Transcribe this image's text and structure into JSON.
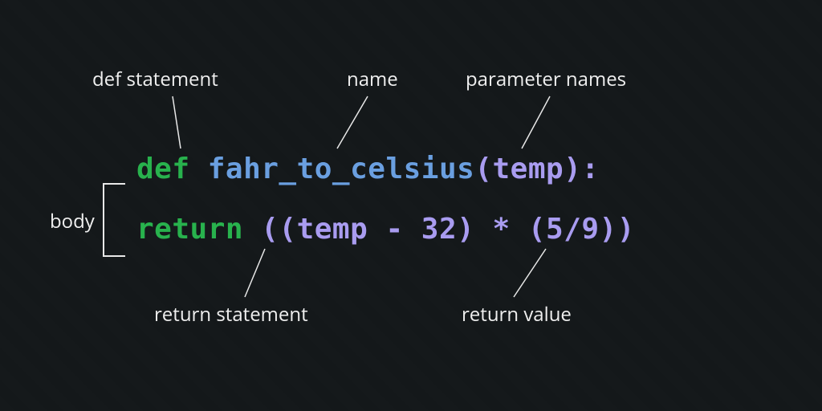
{
  "labels": {
    "def_statement": "def statement",
    "name": "name",
    "parameter_names": "parameter names",
    "body": "body",
    "return_statement": "return statement",
    "return_value": "return value"
  },
  "code": {
    "def": "def",
    "space": " ",
    "func_name": "fahr_to_celsius",
    "params": "(temp):",
    "indent": "    ",
    "return_kw": "return",
    "return_expr": "((temp - 32) * (5/9))"
  }
}
